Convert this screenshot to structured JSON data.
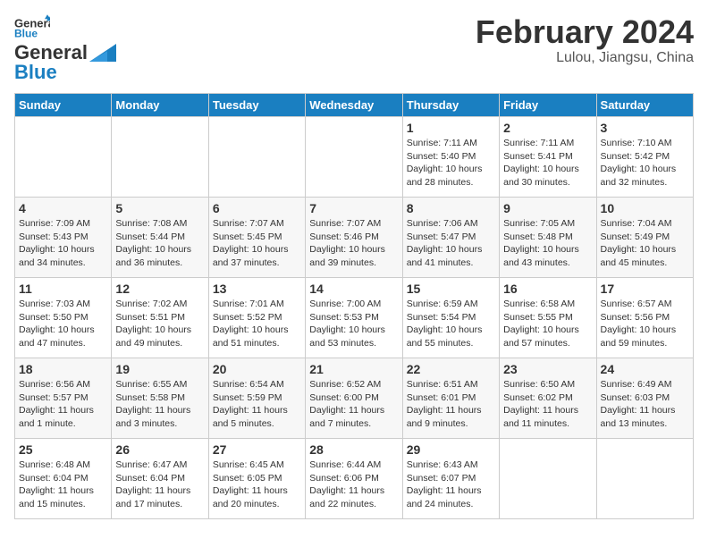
{
  "header": {
    "logo_line1": "General",
    "logo_line2": "Blue",
    "month": "February 2024",
    "location": "Lulou, Jiangsu, China"
  },
  "weekdays": [
    "Sunday",
    "Monday",
    "Tuesday",
    "Wednesday",
    "Thursday",
    "Friday",
    "Saturday"
  ],
  "weeks": [
    [
      {
        "day": "",
        "info": ""
      },
      {
        "day": "",
        "info": ""
      },
      {
        "day": "",
        "info": ""
      },
      {
        "day": "",
        "info": ""
      },
      {
        "day": "1",
        "info": "Sunrise: 7:11 AM\nSunset: 5:40 PM\nDaylight: 10 hours\nand 28 minutes."
      },
      {
        "day": "2",
        "info": "Sunrise: 7:11 AM\nSunset: 5:41 PM\nDaylight: 10 hours\nand 30 minutes."
      },
      {
        "day": "3",
        "info": "Sunrise: 7:10 AM\nSunset: 5:42 PM\nDaylight: 10 hours\nand 32 minutes."
      }
    ],
    [
      {
        "day": "4",
        "info": "Sunrise: 7:09 AM\nSunset: 5:43 PM\nDaylight: 10 hours\nand 34 minutes."
      },
      {
        "day": "5",
        "info": "Sunrise: 7:08 AM\nSunset: 5:44 PM\nDaylight: 10 hours\nand 36 minutes."
      },
      {
        "day": "6",
        "info": "Sunrise: 7:07 AM\nSunset: 5:45 PM\nDaylight: 10 hours\nand 37 minutes."
      },
      {
        "day": "7",
        "info": "Sunrise: 7:07 AM\nSunset: 5:46 PM\nDaylight: 10 hours\nand 39 minutes."
      },
      {
        "day": "8",
        "info": "Sunrise: 7:06 AM\nSunset: 5:47 PM\nDaylight: 10 hours\nand 41 minutes."
      },
      {
        "day": "9",
        "info": "Sunrise: 7:05 AM\nSunset: 5:48 PM\nDaylight: 10 hours\nand 43 minutes."
      },
      {
        "day": "10",
        "info": "Sunrise: 7:04 AM\nSunset: 5:49 PM\nDaylight: 10 hours\nand 45 minutes."
      }
    ],
    [
      {
        "day": "11",
        "info": "Sunrise: 7:03 AM\nSunset: 5:50 PM\nDaylight: 10 hours\nand 47 minutes."
      },
      {
        "day": "12",
        "info": "Sunrise: 7:02 AM\nSunset: 5:51 PM\nDaylight: 10 hours\nand 49 minutes."
      },
      {
        "day": "13",
        "info": "Sunrise: 7:01 AM\nSunset: 5:52 PM\nDaylight: 10 hours\nand 51 minutes."
      },
      {
        "day": "14",
        "info": "Sunrise: 7:00 AM\nSunset: 5:53 PM\nDaylight: 10 hours\nand 53 minutes."
      },
      {
        "day": "15",
        "info": "Sunrise: 6:59 AM\nSunset: 5:54 PM\nDaylight: 10 hours\nand 55 minutes."
      },
      {
        "day": "16",
        "info": "Sunrise: 6:58 AM\nSunset: 5:55 PM\nDaylight: 10 hours\nand 57 minutes."
      },
      {
        "day": "17",
        "info": "Sunrise: 6:57 AM\nSunset: 5:56 PM\nDaylight: 10 hours\nand 59 minutes."
      }
    ],
    [
      {
        "day": "18",
        "info": "Sunrise: 6:56 AM\nSunset: 5:57 PM\nDaylight: 11 hours\nand 1 minute."
      },
      {
        "day": "19",
        "info": "Sunrise: 6:55 AM\nSunset: 5:58 PM\nDaylight: 11 hours\nand 3 minutes."
      },
      {
        "day": "20",
        "info": "Sunrise: 6:54 AM\nSunset: 5:59 PM\nDaylight: 11 hours\nand 5 minutes."
      },
      {
        "day": "21",
        "info": "Sunrise: 6:52 AM\nSunset: 6:00 PM\nDaylight: 11 hours\nand 7 minutes."
      },
      {
        "day": "22",
        "info": "Sunrise: 6:51 AM\nSunset: 6:01 PM\nDaylight: 11 hours\nand 9 minutes."
      },
      {
        "day": "23",
        "info": "Sunrise: 6:50 AM\nSunset: 6:02 PM\nDaylight: 11 hours\nand 11 minutes."
      },
      {
        "day": "24",
        "info": "Sunrise: 6:49 AM\nSunset: 6:03 PM\nDaylight: 11 hours\nand 13 minutes."
      }
    ],
    [
      {
        "day": "25",
        "info": "Sunrise: 6:48 AM\nSunset: 6:04 PM\nDaylight: 11 hours\nand 15 minutes."
      },
      {
        "day": "26",
        "info": "Sunrise: 6:47 AM\nSunset: 6:04 PM\nDaylight: 11 hours\nand 17 minutes."
      },
      {
        "day": "27",
        "info": "Sunrise: 6:45 AM\nSunset: 6:05 PM\nDaylight: 11 hours\nand 20 minutes."
      },
      {
        "day": "28",
        "info": "Sunrise: 6:44 AM\nSunset: 6:06 PM\nDaylight: 11 hours\nand 22 minutes."
      },
      {
        "day": "29",
        "info": "Sunrise: 6:43 AM\nSunset: 6:07 PM\nDaylight: 11 hours\nand 24 minutes."
      },
      {
        "day": "",
        "info": ""
      },
      {
        "day": "",
        "info": ""
      }
    ]
  ]
}
